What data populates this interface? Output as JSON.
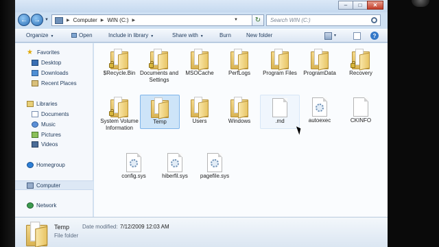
{
  "address_bar": {
    "crumbs": [
      "Computer",
      "WIN (C:)"
    ]
  },
  "search": {
    "placeholder": "Search WIN (C:)"
  },
  "toolbar": {
    "organize": "Organize",
    "open": "Open",
    "include_in_library": "Include in library",
    "share_with": "Share with",
    "burn": "Burn",
    "new_folder": "New folder"
  },
  "navigation": {
    "favorites": "Favorites",
    "desktop": "Desktop",
    "downloads": "Downloads",
    "recent_places": "Recent Places",
    "libraries": "Libraries",
    "documents": "Documents",
    "music": "Music",
    "pictures": "Pictures",
    "videos": "Videos",
    "homegroup": "Homegroup",
    "computer": "Computer",
    "network": "Network"
  },
  "items": {
    "recycle_bin": "$Recycle.Bin",
    "documents_and_settings": "Documents and Settings",
    "msocache": "MSOCache",
    "perflogs": "PerfLogs",
    "program_files": "Program Files",
    "programdata": "ProgramData",
    "recovery": "Recovery",
    "system_volume_information": "System Volume Information",
    "temp": "Temp",
    "users": "Users",
    "windows": "Windows",
    "md": ".md",
    "autoexec": "autoexec",
    "ckinfo": "CKINFO",
    "config_sys": "config.sys",
    "hiberfil_sys": "hiberfil.sys",
    "pagefile_sys": "pagefile.sys"
  },
  "details": {
    "name": "Temp",
    "type": "File folder",
    "modified_label": "Date modified:",
    "modified_value": "7/12/2009 12:03 AM"
  }
}
